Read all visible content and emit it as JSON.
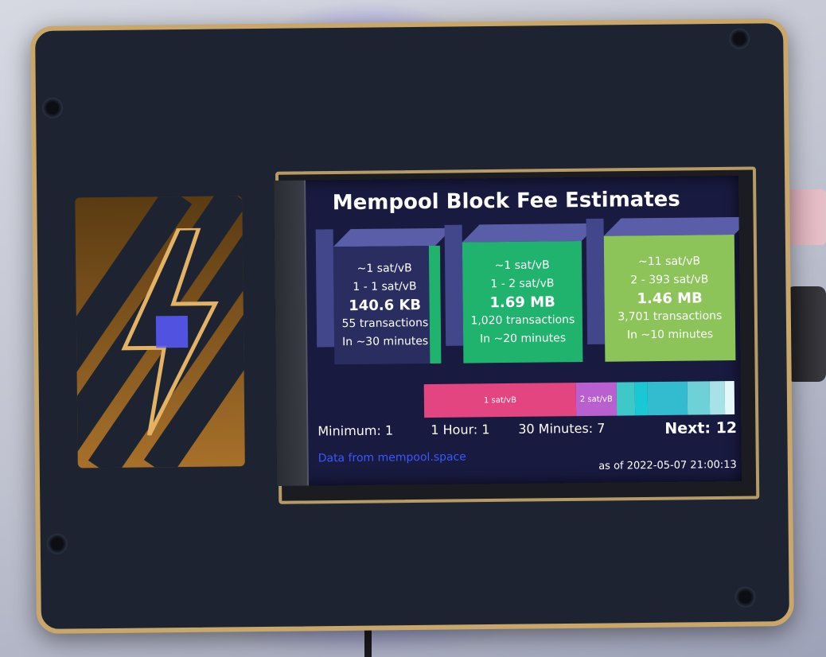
{
  "screen": {
    "title": "Mempool Block Fee Estimates",
    "blocks": [
      {
        "median_fee": "~1 sat/vB",
        "fee_range": "1 - 1 sat/vB",
        "size": "140.6 KB",
        "tx_count": "55 transactions",
        "eta": "In ~30 minutes",
        "fill_fraction": 0.14,
        "color": "#1f9a5c"
      },
      {
        "median_fee": "~1 sat/vB",
        "fee_range": "1 - 2 sat/vB",
        "size": "1.69 MB",
        "tx_count": "1,020 transactions",
        "eta": "In ~20 minutes",
        "fill_fraction": 1.0,
        "color": "#1fb36e"
      },
      {
        "median_fee": "~11 sat/vB",
        "fee_range": "2 - 393 sat/vB",
        "size": "1.46 MB",
        "tx_count": "3,701 transactions",
        "eta": "In ~10 minutes",
        "fill_fraction": 1.0,
        "color": "#8cc45a"
      }
    ],
    "fee_distribution": [
      {
        "label": "1 sat/vB",
        "color": "#e2457f",
        "share": 0.49
      },
      {
        "label": "2 sat/vB",
        "color": "#b95fd0",
        "share": 0.13
      },
      {
        "label": "",
        "color": "#3fc8c8",
        "share": 0.06
      },
      {
        "label": "",
        "color": "#19c8d4",
        "share": 0.04
      },
      {
        "label": "",
        "color": "#33bcd0",
        "share": 0.13
      },
      {
        "label": "",
        "color": "#6fd1d8",
        "share": 0.07
      },
      {
        "label": "",
        "color": "#a6e2e8",
        "share": 0.05
      },
      {
        "label": "",
        "color": "#e4f7f9",
        "share": 0.03
      }
    ],
    "stats": {
      "minimum": "Minimum: 1",
      "one_hour": "1 Hour: 1",
      "thirty_minutes": "30 Minutes: 7",
      "next": "Next: 12"
    },
    "source": "Data from mempool.space",
    "timestamp": "as of 2022-05-07 21:00:13"
  }
}
